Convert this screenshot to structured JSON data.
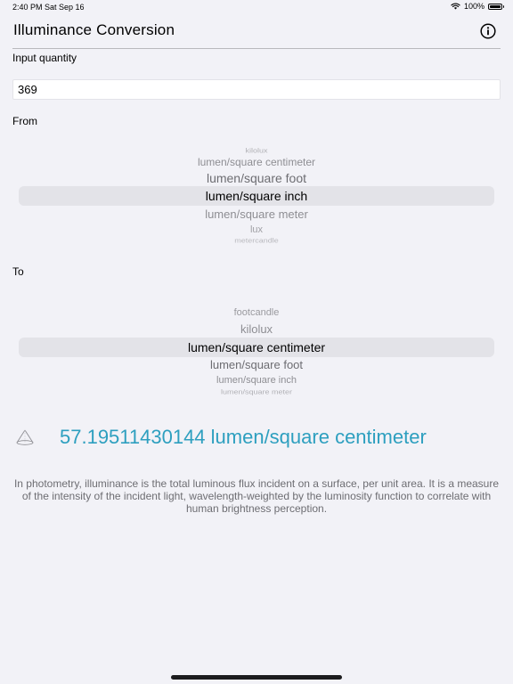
{
  "status_bar": {
    "time_date": "2:40 PM   Sat Sep 16",
    "battery": "100%"
  },
  "header": {
    "title": "Illuminance Conversion"
  },
  "input": {
    "label": "Input quantity",
    "value": "369"
  },
  "from_picker": {
    "label": "From",
    "items": [
      "kilolux",
      "lumen/square centimeter",
      "lumen/square foot",
      "lumen/square inch",
      "lumen/square meter",
      "lux",
      "metercandle"
    ],
    "selected": "lumen/square inch"
  },
  "to_picker": {
    "label": "To",
    "items": [
      "footcandle",
      "kilolux",
      "lumen/square centimeter",
      "lumen/square foot",
      "lumen/square inch",
      "lumen/square meter"
    ],
    "selected": "lumen/square centimeter"
  },
  "result": {
    "text": "57.19511430144 lumen/square centimeter"
  },
  "description": "In photometry, illuminance is the total luminous flux incident on a surface, per unit area. It is a measure of the intensity of the incident light, wavelength-weighted by the luminosity function to correlate with human brightness perception.",
  "colors": {
    "accent": "#2d9fbf",
    "background": "#f2f2f7"
  }
}
